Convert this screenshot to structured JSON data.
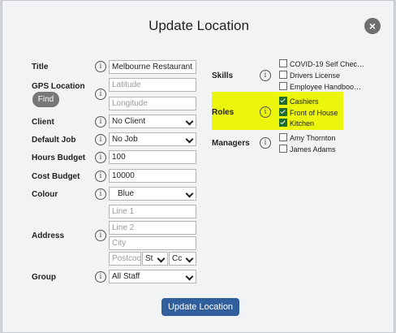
{
  "dialog": {
    "title": "Update Location",
    "close_icon": "close-icon",
    "submit_label": "Update Location"
  },
  "fields": {
    "title": {
      "label": "Title",
      "value": "Melbourne Restaurant"
    },
    "gps": {
      "label": "GPS Location",
      "find_label": "Find",
      "latitude_placeholder": "Latitude",
      "longitude_placeholder": "Longitude"
    },
    "client": {
      "label": "Client",
      "value": "No Client"
    },
    "default_job": {
      "label": "Default Job",
      "value": "No Job"
    },
    "hours_budget": {
      "label": "Hours Budget",
      "value": "100"
    },
    "cost_budget": {
      "label": "Cost Budget",
      "value": "10000"
    },
    "colour": {
      "label": "Colour",
      "value": "Blue"
    },
    "address": {
      "label": "Address",
      "line1_placeholder": "Line 1",
      "line2_placeholder": "Line 2",
      "city_placeholder": "City",
      "postcode_placeholder": "Postcoc",
      "state_value": "St",
      "country_value": "Cc"
    },
    "group": {
      "label": "Group",
      "value": "All Staff"
    }
  },
  "skills": {
    "label": "Skills",
    "items": [
      {
        "label": "COVID-19 Self Chec…",
        "checked": false
      },
      {
        "label": "Drivers License",
        "checked": false
      },
      {
        "label": "Employee Handboo…",
        "checked": false
      }
    ]
  },
  "roles": {
    "label": "Roles",
    "highlight_color": "#ecf50c",
    "items": [
      {
        "label": "Cashiers",
        "checked": true
      },
      {
        "label": "Front of House",
        "checked": true
      },
      {
        "label": "Kitchen",
        "checked": true
      }
    ]
  },
  "managers": {
    "label": "Managers",
    "items": [
      {
        "label": "Amy Thornton",
        "checked": false
      },
      {
        "label": "James Adams",
        "checked": false
      }
    ]
  },
  "info_glyph": "i",
  "colors": {
    "primary_button": "#315f9c",
    "find_button": "#777777",
    "checkbox_checked": "#1f6c2d"
  }
}
